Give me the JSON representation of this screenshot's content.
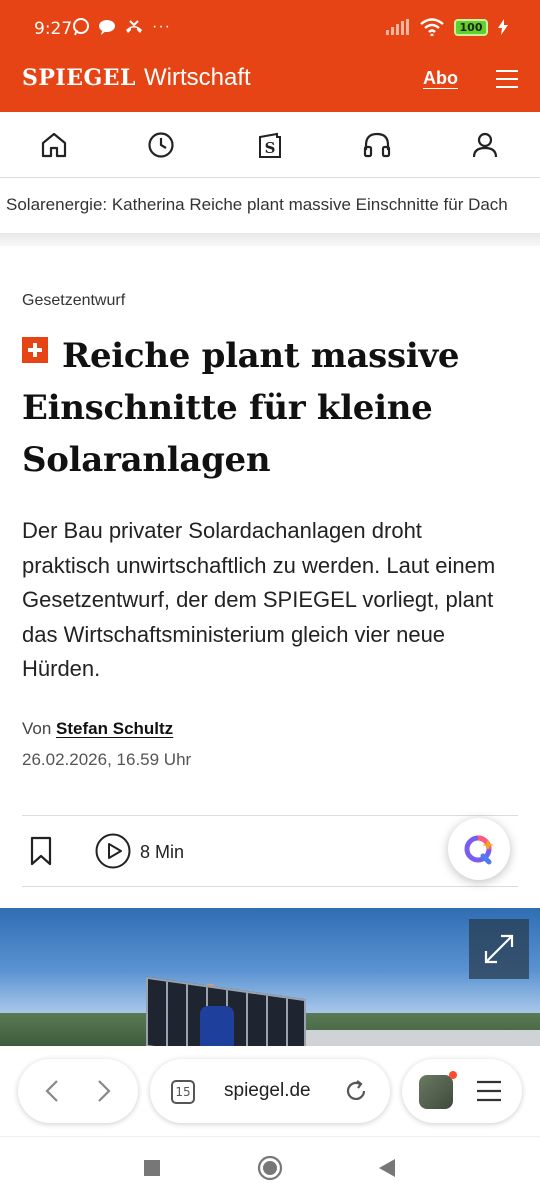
{
  "status_bar": {
    "time": "9:27",
    "more": "···",
    "battery": "100"
  },
  "header": {
    "brand": "SPIEGEL",
    "section": "Wirtschaft",
    "abo_label": "Abo",
    "menu_icon": "hamburger-icon"
  },
  "nav": {
    "icons": [
      "home-icon",
      "clock-icon",
      "spiegel-s-icon",
      "headphones-icon",
      "account-icon"
    ]
  },
  "breadcrumb": {
    "text": "Solarenergie: Katherina Reiche plant massive Einschnitte für Dach"
  },
  "article": {
    "kicker": "Gesetzentwurf",
    "headline": "Reiche plant massive Einschnitte für kleine Solaranlagen",
    "teaser": "Der Bau privater Solardachanlagen droht praktisch unwirtschaftlich zu werden. Laut einem Gesetzentwurf, der dem SPIEGEL vorliegt, plant das Wirtschaftsministerium gleich vier neue Hürden.",
    "byline_prefix": "Von",
    "author": "Stefan Schultz",
    "date": "26.02.2026, 16.59 Uhr",
    "read_time": "8 Min"
  },
  "browser": {
    "tab_count": "15",
    "url": "spiegel.de"
  },
  "colors": {
    "brand_orange": "#e64415",
    "battery_green": "#5fd12a"
  }
}
